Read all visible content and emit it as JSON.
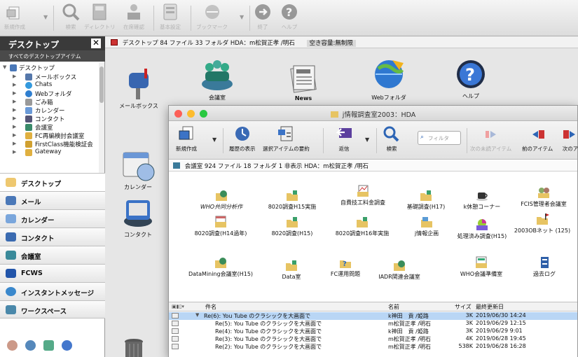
{
  "toolbar": {
    "items": [
      {
        "label": "新規作成",
        "icon": "new-document-icon"
      },
      {
        "label": "検索",
        "icon": "magnifier-icon"
      },
      {
        "label": "ディレクトリ",
        "icon": "directory-book-icon"
      },
      {
        "label": "在席確認",
        "icon": "presence-person-icon"
      },
      {
        "label": "基本設定",
        "icon": "settings-panel-icon"
      },
      {
        "label": "ブックマーク",
        "icon": "bookmark-icon"
      },
      {
        "label": "終了",
        "icon": "exit-icon"
      },
      {
        "label": "ヘルプ",
        "icon": "help-icon"
      }
    ]
  },
  "sidebar": {
    "title": "デスクトップ",
    "close": "✕",
    "subtitle": "すべてのデスクトップアイテム",
    "tree": [
      {
        "label": "デスクトップ",
        "level": 0,
        "expanded": true,
        "icon": "desktop-icon"
      },
      {
        "label": "メールボックス",
        "level": 1,
        "icon": "mailbox-icon"
      },
      {
        "label": "Chats",
        "level": 1,
        "icon": "chats-icon"
      },
      {
        "label": "Webフォルダ",
        "level": 1,
        "icon": "web-folder-icon"
      },
      {
        "label": "ごみ箱",
        "level": 1,
        "icon": "trash-icon"
      },
      {
        "label": "カレンダー",
        "level": 1,
        "icon": "calendar-icon"
      },
      {
        "label": "コンタクト",
        "level": 1,
        "icon": "contact-icon"
      },
      {
        "label": "会議室",
        "level": 1,
        "icon": "conference-icon"
      },
      {
        "label": "FC再編検討会議室",
        "level": 1,
        "icon": "folder-icon"
      },
      {
        "label": "FirstClass機能検証会",
        "level": 1,
        "icon": "folder-icon"
      },
      {
        "label": "Gateway",
        "level": 1,
        "icon": "folder-icon"
      }
    ],
    "nav": [
      {
        "label": "デスクトップ",
        "icon": "desktop-icon",
        "selected": true
      },
      {
        "label": "メール",
        "icon": "mail-icon"
      },
      {
        "label": "カレンダー",
        "icon": "calendar-icon"
      },
      {
        "label": "コンタクト",
        "icon": "contact-icon"
      },
      {
        "label": "会議室",
        "icon": "conference-icon"
      },
      {
        "label": "FCWS",
        "icon": "fcws-icon"
      },
      {
        "label": "インスタントメッセージ",
        "icon": "instant-message-icon"
      },
      {
        "label": "ワークスペース",
        "icon": "workspace-icon"
      }
    ]
  },
  "desktop": {
    "path": "デスクトップ   84 ファイル  33 フォルダ   HDA：m松賀正孝 /明石",
    "quota": "空き容量:無制限",
    "icons": [
      {
        "label": "メールボックス",
        "icon": "mailbox-icon"
      },
      {
        "label": "会議室",
        "icon": "conference-icon"
      },
      {
        "label": "News",
        "icon": "news-icon"
      },
      {
        "label": "Webフォルダ",
        "icon": "web-folder-icon"
      },
      {
        "label": "ヘルプ",
        "icon": "help-icon"
      },
      {
        "label": "カレンダー",
        "icon": "calendar-icon"
      },
      {
        "label": "コンタクト",
        "icon": "contact-icon"
      }
    ]
  },
  "window": {
    "title": "j情報調査室2003：HDA",
    "toolbar": [
      {
        "label": "新規作成",
        "icon": "new-document-icon",
        "enabled": true
      },
      {
        "label": "履歴の表示",
        "icon": "history-icon",
        "enabled": true
      },
      {
        "label": "選択アイテムの要約",
        "icon": "summary-icon",
        "enabled": true
      },
      {
        "label": "返信",
        "icon": "reply-icon",
        "enabled": true
      },
      {
        "label": "検索",
        "icon": "magnifier-icon",
        "enabled": true
      },
      {
        "label": "次の未読アイテム",
        "icon": "next-unread-icon",
        "enabled": false
      },
      {
        "label": "前のアイテム",
        "icon": "previous-item-icon",
        "enabled": true
      },
      {
        "label": "次のア",
        "icon": "next-item-icon",
        "enabled": true
      }
    ],
    "filter_placeholder": "フィルタ",
    "path": "会議室   924 ファイル  18 フォルダ  1 非表示   HDA：m松賀正孝 /明石",
    "folders": [
      [
        "WHO共同分析作",
        "8020調査H15実施",
        "自費技工料金調査",
        "基礎調査(H17)",
        "k休憩コーナー",
        "FCIS管理者会議室"
      ],
      [
        "8020調査(H14過年)",
        "8020調査(H15)",
        "8020調査H16年実施",
        "j情報企画",
        "処理済み調査(H15)",
        "2003OBネット (125)"
      ],
      [
        "DataMining会議室(H15)",
        "Data室",
        "FC運用問題",
        "IADR関連会議室",
        "WHO会議準備室",
        "過去ログ"
      ]
    ],
    "list": {
      "columns": {
        "subject": "件名",
        "name": "名前",
        "size": "サイズ",
        "date": "最終更新日"
      },
      "rows": [
        {
          "subject": "Re(6): You Tube のクラシックを大画面で",
          "name": "k神田　貢 /姫路",
          "size": "3K",
          "date": "2019/06/30  14:24",
          "selected": true
        },
        {
          "subject": "Re(5): You Tube のクラシックを大画面で",
          "name": "m松賀正孝 /明石",
          "size": "3K",
          "date": "2019/06/29  12:15"
        },
        {
          "subject": "Re(4): You Tube のクラシックを大画面で",
          "name": "k神田　貢 /姫路",
          "size": "3K",
          "date": "2019/06/29  9:01"
        },
        {
          "subject": "Re(3): You Tube のクラシックを大画面で",
          "name": "m松賀正孝 /明石",
          "size": "4K",
          "date": "2019/06/28  19:45"
        },
        {
          "subject": "Re(2): You Tube のクラシックを大画面で",
          "name": "m松賀正孝 /明石",
          "size": "538K",
          "date": "2019/06/28  16:28"
        }
      ]
    }
  },
  "colors": {
    "accent": "#3d7ccf",
    "selection": "#b9d6f5",
    "folder": "#e7c463"
  }
}
